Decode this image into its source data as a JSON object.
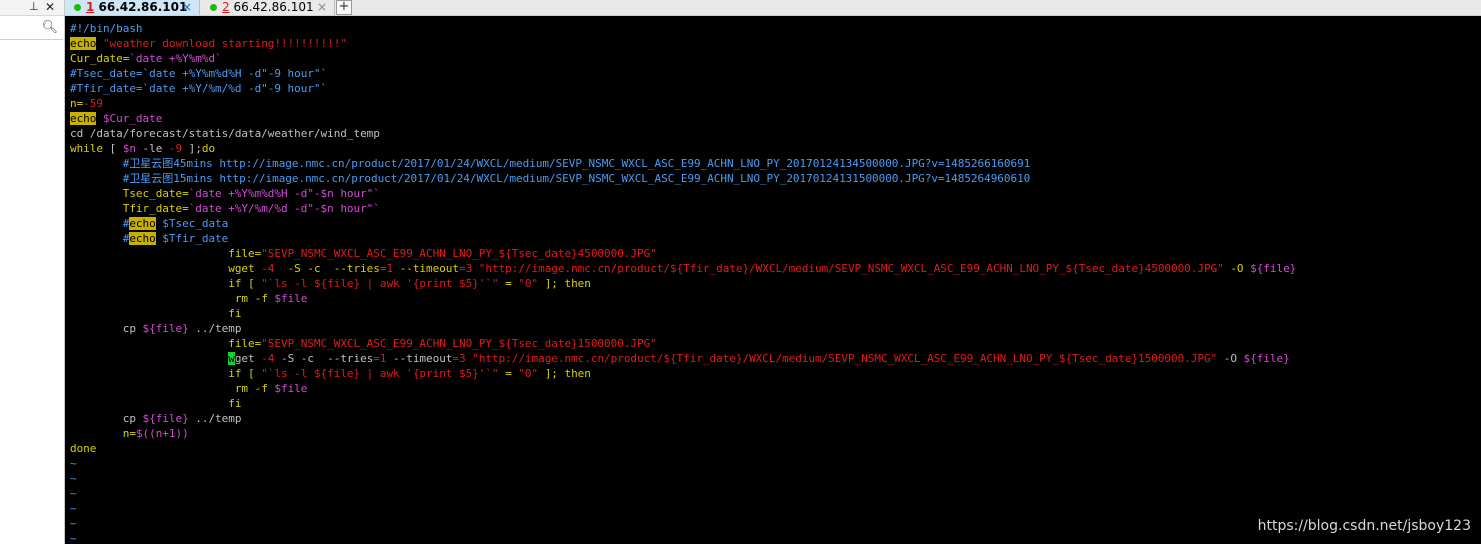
{
  "left_panel": {
    "pin_glyph": "⊥",
    "close_glyph": "✕",
    "search_icon": "magnifier"
  },
  "tabs": [
    {
      "num": "1",
      "host": " 66.42.86.101",
      "close": "×"
    },
    {
      "num": "2",
      "host": " 66.42.86.101",
      "close": "×"
    }
  ],
  "new_tab_label": "+",
  "terminal": {
    "lines": [
      "#!/bin/bash",
      "echo \"weather download starting!!!!!!!!!!\"",
      "Cur_date=`date +%Y%m%d`",
      "#Tsec_date=`date +%Y%m%d%H -d\"-9 hour\"`",
      "#Tfir_date=`date +%Y/%m/%d -d\"-9 hour\"`",
      "n=-59",
      "echo $Cur_date",
      "cd /data/forecast/statis/data/weather/wind_temp",
      "while [ $n -le -9 ];do",
      "        #卫星云图45mins http://image.nmc.cn/product/2017/01/24/WXCL/medium/SEVP_NSMC_WXCL_ASC_E99_ACHN_LNO_PY_20170124134500000.JPG?v=1485266160691",
      "        #卫星云图15mins http://image.nmc.cn/product/2017/01/24/WXCL/medium/SEVP_NSMC_WXCL_ASC_E99_ACHN_LNO_PY_20170124131500000.JPG?v=1485264960610",
      "        Tsec_date=`date +%Y%m%d%H -d\"-$n hour\"`",
      "        Tfir_date=`date +%Y/%m/%d -d\"-$n hour\"`",
      "        #echo $Tsec_data",
      "        #echo $Tfir_date",
      "                        file=\"SEVP_NSMC_WXCL_ASC_E99_ACHN_LNO_PY_${Tsec_date}4500000.JPG\"",
      "                        wget -4  -S -c  --tries=1 --timeout=3 \"http://image.nmc.cn/product/${Tfir_date}/WXCL/medium/SEVP_NSMC_WXCL_ASC_E99_ACHN_LNO_PY_${Tsec_date}4500000.JPG\" -O ${file}",
      "                        if [ \"`ls -l ${file} | awk '{print $5}'`\" = \"0\" ]; then",
      "                         rm -f $file",
      "                        fi",
      "        cp ${file} ../temp",
      "                        file=\"SEVP_NSMC_WXCL_ASC_E99_ACHN_LNO_PY_${Tsec_date}1500000.JPG\"",
      "                        wget -4 -S -c  --tries=1 --timeout=3 \"http://image.nmc.cn/product/${Tfir_date}/WXCL/medium/SEVP_NSMC_WXCL_ASC_E99_ACHN_LNO_PY_${Tsec_date}1500000.JPG\" -O ${file}",
      "                        if [ \"`ls -l ${file} | awk '{print $5}'`\" = \"0\" ]; then",
      "                         rm -f $file",
      "                        fi",
      "        cp ${file} ../temp",
      "        n=$((n+1))",
      "done",
      "~",
      "~",
      "~",
      "~",
      "~",
      "~"
    ],
    "highlighted_word": "echo",
    "cursor_line": 22
  },
  "watermark": "https://blog.csdn.net/jsboy123",
  "colors": {
    "terminal_bg": "#000000",
    "comment": "#4a9cf2",
    "string": "#e11b1b",
    "keyword": "#d9d200",
    "variable": "#d34cd3",
    "search_highlight": "#c7b000",
    "cursor": "#12d12f",
    "tab_active": "#cfe6f7",
    "status_dot": "#1fb80e"
  }
}
